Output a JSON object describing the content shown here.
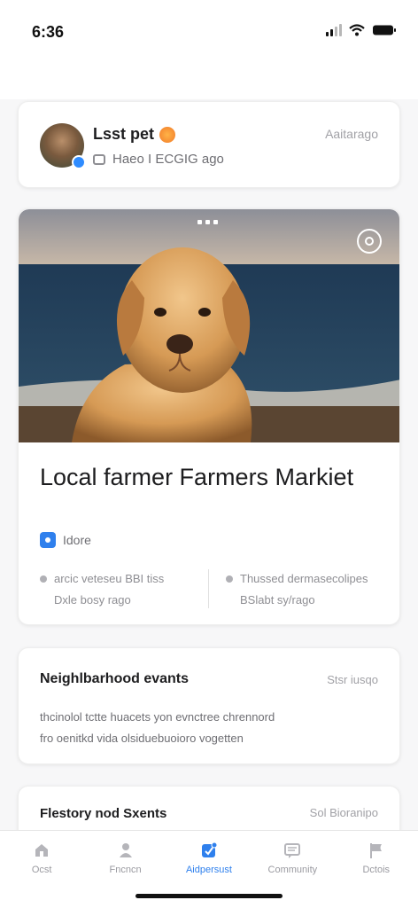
{
  "status_bar": {
    "time": "6:36"
  },
  "profile": {
    "name": "Lsst pet",
    "subtitle": "Haeo I ECGIG ago",
    "action": "Aaitarago"
  },
  "post": {
    "title": "Local farmer Farmers Markiet",
    "tag_label": "Idore",
    "meta_left": [
      "arcic veteseu BBI tiss",
      "Dxle bosy rago"
    ],
    "meta_right": [
      "Thussed dermasecolipes",
      "BSlabt sy/rago"
    ],
    "image_description_icon": "camera-icon"
  },
  "neighborhood": {
    "title": "Neighlbarhood evants",
    "action": "Stsr iusqo",
    "body_lines": [
      "thcinolol tctte huacets yon evnctree chrennord",
      "fro oenitkd vida olsiduebuoioro vogetten"
    ]
  },
  "partial": {
    "title": "Flestory nod Sxents",
    "action": "Sol Bioranipo"
  },
  "bottom_nav": {
    "items": [
      {
        "label": "Ocst",
        "icon": "home-icon"
      },
      {
        "label": "Fncncn",
        "icon": "user-icon"
      },
      {
        "label": "Aidpersust",
        "icon": "check-square-icon"
      },
      {
        "label": "Community",
        "icon": "chat-icon"
      },
      {
        "label": "Dctois",
        "icon": "flag-icon"
      }
    ]
  },
  "colors": {
    "accent": "#2f80ed",
    "background": "#f7f7f8"
  }
}
